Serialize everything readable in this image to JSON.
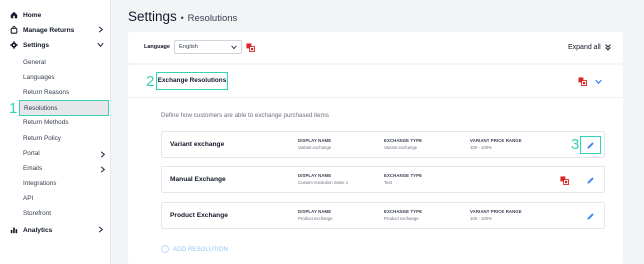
{
  "sidebar": {
    "home": "Home",
    "manage_returns": "Manage Returns",
    "settings": "Settings",
    "items": [
      {
        "label": "General"
      },
      {
        "label": "Languages"
      },
      {
        "label": "Return Reasons"
      },
      {
        "label": "Resolutions"
      },
      {
        "label": "Return Methods"
      },
      {
        "label": "Return Policy"
      },
      {
        "label": "Portal"
      },
      {
        "label": "Emails"
      },
      {
        "label": "Integrations"
      },
      {
        "label": "API"
      },
      {
        "label": "Storefront"
      }
    ],
    "analytics": "Analytics"
  },
  "annotations": {
    "one": "1",
    "two": "2",
    "three": "3"
  },
  "header": {
    "title": "Settings",
    "separator": "•",
    "subtitle": "Resolutions"
  },
  "language": {
    "label": "Language",
    "value": "English",
    "expand_all": "Expand all"
  },
  "resolutions": {
    "title": "Exchange Resolutions",
    "description": "Define how customers are able to exchange purchased items",
    "rows": [
      {
        "name": "Variant exchange",
        "display_name_h": "DISPLAY NAME",
        "display_name": "Variant exchange",
        "type_h": "EXCHANGE TYPE",
        "type": "Variant exchange",
        "price_h": "VARIANT PRICE RANGE",
        "price": "100 - 100%"
      },
      {
        "name": "Manual Exchange",
        "display_name_h": "DISPLAY NAME",
        "display_name": "Custom resolution name 1",
        "type_h": "EXCHANGE TYPE",
        "type": "Test",
        "price_h": "",
        "price": ""
      },
      {
        "name": "Product Exchange",
        "display_name_h": "DISPLAY NAME",
        "display_name": "Product exchange",
        "type_h": "EXCHANGE TYPE",
        "type": "Product exchange",
        "price_h": "VARIANT PRICE RANGE",
        "price": "100 - 100%"
      }
    ],
    "add_label": "ADD RESOLUTION"
  },
  "colors": {
    "accent": "#34d3b4",
    "translate_red": "#dc2626",
    "edit_blue": "#3b82f6"
  }
}
